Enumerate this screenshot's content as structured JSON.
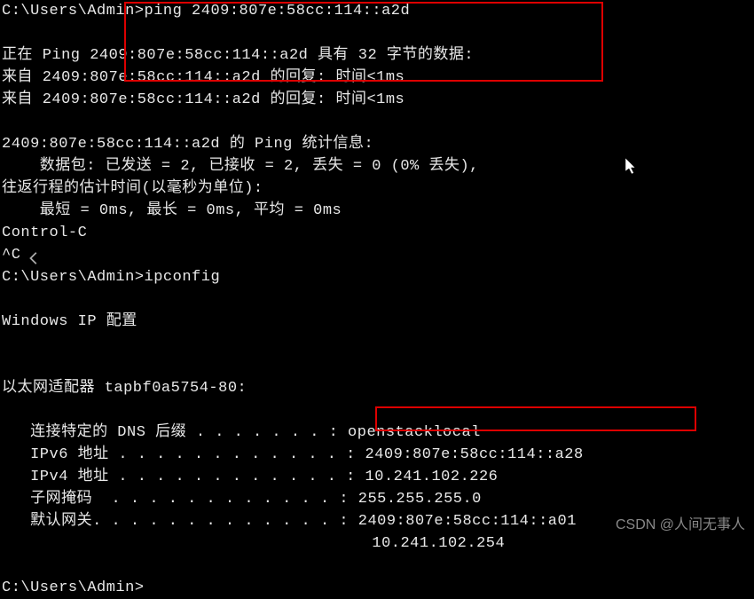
{
  "terminal": {
    "lines": [
      {
        "prompt": "C:\\Users\\Admin>",
        "cmd": "ping 2409:807e:58cc:114::a2d"
      },
      {
        "text": ""
      },
      {
        "text": "正在 Ping 2409:807e:58cc:114::a2d 具有 32 字节的数据:"
      },
      {
        "text": "来自 2409:807e:58cc:114::a2d 的回复: 时间<1ms"
      },
      {
        "text": "来自 2409:807e:58cc:114::a2d 的回复: 时间<1ms"
      },
      {
        "text": ""
      },
      {
        "text": "2409:807e:58cc:114::a2d 的 Ping 统计信息:"
      },
      {
        "text": "    数据包: 已发送 = 2, 已接收 = 2, 丢失 = 0 (0% 丢失),"
      },
      {
        "text": "往返行程的估计时间(以毫秒为单位):"
      },
      {
        "text": "    最短 = 0ms, 最长 = 0ms, 平均 = 0ms"
      },
      {
        "text": "Control-C"
      },
      {
        "text": "^C"
      },
      {
        "prompt": "C:\\Users\\Admin>",
        "cmd": "ipconfig"
      },
      {
        "text": ""
      },
      {
        "text": "Windows IP 配置"
      },
      {
        "text": ""
      },
      {
        "text": ""
      },
      {
        "text": "以太网适配器 tapbf0a5754-80:"
      },
      {
        "text": ""
      },
      {
        "text": "   连接特定的 DNS 后缀 . . . . . . . : openstacklocal"
      },
      {
        "text": "   IPv6 地址 . . . . . . . . . . . . : 2409:807e:58cc:114::a28"
      },
      {
        "text": "   IPv4 地址 . . . . . . . . . . . . : 10.241.102.226"
      },
      {
        "text": "   子网掩码  . . . . . . . . . . . . : 255.255.255.0"
      },
      {
        "text": "   默认网关. . . . . . . . . . . . . : 2409:807e:58cc:114::a01"
      },
      {
        "text": "                                       10.241.102.254"
      },
      {
        "text": ""
      },
      {
        "prompt": "C:\\Users\\Admin>",
        "cmd": ""
      }
    ]
  },
  "watermark": "CSDN @人间无事人"
}
